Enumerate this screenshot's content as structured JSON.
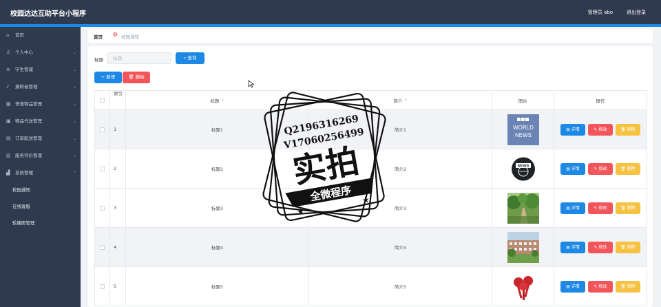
{
  "app": {
    "title": "校园达达互助平台小程序",
    "user_label": "管理员 abo",
    "logout_label": "退出登录"
  },
  "sidebar": {
    "items": [
      {
        "label": "首页",
        "icon": "home-icon",
        "glyph": "⌂"
      },
      {
        "label": "个人中心",
        "icon": "person-icon",
        "glyph": "♙",
        "chevron": "⌄"
      },
      {
        "label": "学生管理",
        "icon": "list-icon",
        "glyph": "≡",
        "chevron": "⌄"
      },
      {
        "label": "兼职者管理",
        "icon": "mic-icon",
        "glyph": "♪",
        "chevron": "⌄"
      },
      {
        "label": "快递物品管理",
        "icon": "grid-icon",
        "glyph": "▦",
        "chevron": "⌄"
      },
      {
        "label": "物品代送管理",
        "icon": "box-icon",
        "glyph": "▣",
        "chevron": "⌄"
      },
      {
        "label": "订单配送管理",
        "icon": "doc-icon",
        "glyph": "▤",
        "chevron": "⌄"
      },
      {
        "label": "服务评价管理",
        "icon": "layers-icon",
        "glyph": "▥",
        "chevron": "⌄"
      },
      {
        "label": "系统管理",
        "icon": "chart-icon",
        "glyph": "▟",
        "chevron": "⌃"
      }
    ],
    "subitems": [
      {
        "label": "校园通知"
      },
      {
        "label": "在线客服"
      },
      {
        "label": "轮播图管理"
      }
    ]
  },
  "breadcrumb": {
    "home": "首页",
    "current": "校园通知",
    "sep_glyph": "❂"
  },
  "search": {
    "label": "标题",
    "placeholder": "标题",
    "value": "",
    "query_label": "⌕ 查询"
  },
  "toolbar": {
    "add_label": "+ 新增",
    "delete_label": "🗑 删除"
  },
  "table": {
    "headers": {
      "index": "索引",
      "title": "标题",
      "intro": "简介",
      "image": "图片",
      "ops": "操作",
      "sort_glyph": "⇕"
    },
    "op_labels": {
      "detail": "▤ 详情",
      "edit": "✎ 修改",
      "delete": "🗑 删除"
    },
    "rows": [
      {
        "index": "1",
        "title": "标题1",
        "intro": "简介1",
        "image": "bbc-world-news-logo"
      },
      {
        "index": "2",
        "title": "标题2",
        "intro": "简介2",
        "image": "news-globe-icon"
      },
      {
        "index": "3",
        "title": "标题3",
        "intro": "简介3",
        "image": "campus-trees-photo"
      },
      {
        "index": "4",
        "title": "标题4",
        "intro": "简介4",
        "image": "campus-building-photo"
      },
      {
        "index": "5",
        "title": "标题5",
        "intro": "简介5",
        "image": "microphones-icon"
      }
    ],
    "image_text": {
      "bbc": [
        "BBC",
        "WORLD",
        "NEWS"
      ],
      "news": "NEWS"
    }
  },
  "watermark": {
    "line1": "Q2196316269",
    "line2": "V17060256499",
    "big": "实拍",
    "banner": "全微程序"
  },
  "colors": {
    "primary": "#1e88e5",
    "danger": "#f2555a",
    "warning": "#f5c242",
    "sidebar": "#2f3a4e"
  }
}
